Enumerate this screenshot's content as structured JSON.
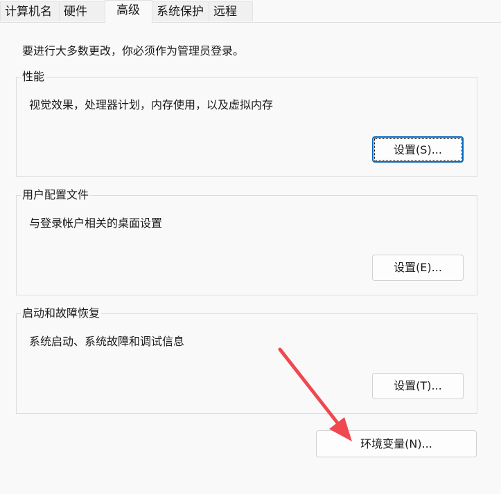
{
  "tabs": [
    "计算机名",
    "硬件",
    "高级",
    "系统保护",
    "远程"
  ],
  "active_tab": "高级",
  "intro": "要进行大多数更改，你必须作为管理员登录。",
  "groups": [
    {
      "title": "性能",
      "desc": "视觉效果，处理器计划，内存使用，以及虚拟内存",
      "button": "设置(S)..."
    },
    {
      "title": "用户配置文件",
      "desc": "与登录帐户相关的桌面设置",
      "button": "设置(E)..."
    },
    {
      "title": "启动和故障恢复",
      "desc": "系统启动、系统故障和调试信息",
      "button": "设置(T)..."
    }
  ],
  "env_button": "环境变量(N)...",
  "arrow_color": "#f04850"
}
